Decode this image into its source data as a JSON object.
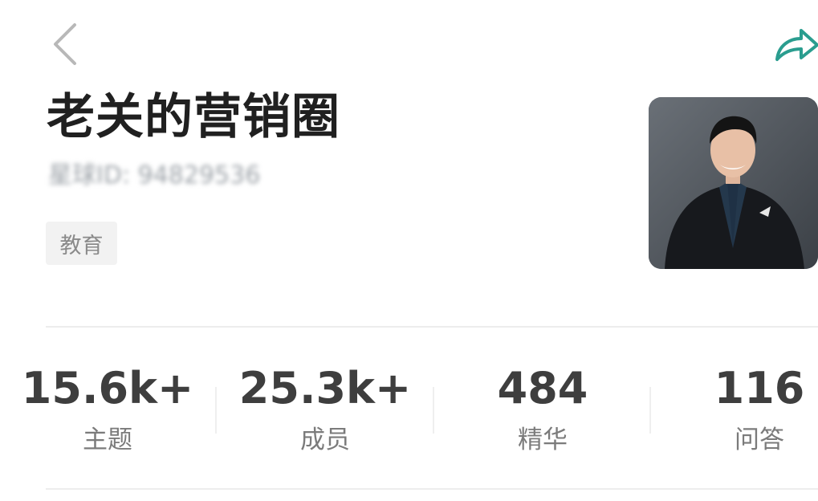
{
  "header": {
    "back_icon": "back-chevron-icon",
    "share_icon": "share-arrow-icon"
  },
  "circle": {
    "title": "老关的营销圈",
    "id_text": "星球ID: 94829536",
    "tag": "教育",
    "avatar_icon": "owner-avatar"
  },
  "stats": {
    "topics": {
      "value": "15.6k+",
      "label": "主题"
    },
    "members": {
      "value": "25.3k+",
      "label": "成员"
    },
    "essence": {
      "value": "484",
      "label": "精华"
    },
    "qa": {
      "value": "116",
      "label": "问答"
    }
  },
  "colors": {
    "share_icon": "#2a9d8f",
    "back_icon": "#b8b8b8",
    "text_primary": "#202020",
    "text_secondary": "#7b7b7b",
    "divider": "#ededed"
  }
}
